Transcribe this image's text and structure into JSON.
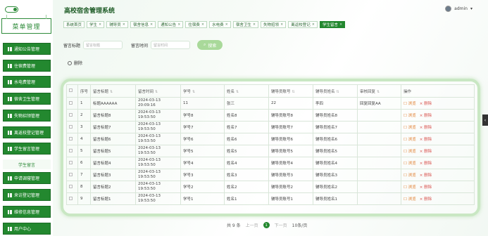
{
  "header": {
    "title": "高校宿舍管理系统",
    "user": "admin",
    "user_caret": "▾"
  },
  "sidebar": {
    "title": "菜单管理",
    "items": [
      {
        "label": "通知公告管理"
      },
      {
        "label": "住宿费管理"
      },
      {
        "label": "水电费管理"
      },
      {
        "label": "宿舍卫生管理"
      },
      {
        "label": "失物招领管理"
      },
      {
        "label": "离返校登记管理"
      },
      {
        "label": "学生留言管理"
      },
      {
        "label": "学生留言",
        "sub": true
      },
      {
        "label": "申请调寝管理"
      },
      {
        "label": "来访登记管理"
      },
      {
        "label": "维修信息管理"
      },
      {
        "label": "用户中心"
      }
    ]
  },
  "tabs": [
    {
      "label": "系统首页",
      "closable": false
    },
    {
      "label": "学生",
      "closable": true
    },
    {
      "label": "辅导员",
      "closable": true
    },
    {
      "label": "宿舍信息",
      "closable": true
    },
    {
      "label": "通知公告",
      "closable": true
    },
    {
      "label": "住宿费",
      "closable": true
    },
    {
      "label": "水电费",
      "closable": true
    },
    {
      "label": "宿舍卫生",
      "closable": true
    },
    {
      "label": "失物招领",
      "closable": true
    },
    {
      "label": "离返校登记",
      "closable": true
    },
    {
      "label": "学生留言",
      "closable": true,
      "active": true
    }
  ],
  "search": {
    "title_label": "留言标题",
    "title_placeholder": "留言标题",
    "time_label": "留言时间",
    "time_placeholder": "留言时间",
    "button": "搜索"
  },
  "delete_label": "删除",
  "table": {
    "columns": [
      "序号",
      "留言标题",
      "留言时间",
      "学号",
      "姓名",
      "辅导员账号",
      "辅导员姓名",
      "审核回复",
      "操作"
    ],
    "rows": [
      {
        "no": "1",
        "title": "标题AAAAAA",
        "time": "2024-03-13 20:09:16",
        "sid": "11",
        "name": "张三",
        "acct": "22",
        "tname": "李四",
        "reply": "回复回复AA"
      },
      {
        "no": "2",
        "title": "留言标题8",
        "time": "2024-03-13 19:53:50",
        "sid": "学号8",
        "name": "姓名8",
        "acct": "辅导员账号8",
        "tname": "辅导员姓名8",
        "reply": ""
      },
      {
        "no": "3",
        "title": "留言标题7",
        "time": "2024-03-13 19:53:50",
        "sid": "学号7",
        "name": "姓名7",
        "acct": "辅导员账号7",
        "tname": "辅导员姓名7",
        "reply": ""
      },
      {
        "no": "4",
        "title": "留言标题6",
        "time": "2024-03-13 19:53:50",
        "sid": "学号6",
        "name": "姓名6",
        "acct": "辅导员账号6",
        "tname": "辅导员姓名6",
        "reply": ""
      },
      {
        "no": "5",
        "title": "留言标题5",
        "time": "2024-03-13 19:53:50",
        "sid": "学号5",
        "name": "姓名5",
        "acct": "辅导员账号5",
        "tname": "辅导员姓名5",
        "reply": ""
      },
      {
        "no": "6",
        "title": "留言标题4",
        "time": "2024-03-13 19:53:50",
        "sid": "学号4",
        "name": "姓名4",
        "acct": "辅导员账号4",
        "tname": "辅导员姓名4",
        "reply": ""
      },
      {
        "no": "7",
        "title": "留言标题3",
        "time": "2024-03-13 19:53:50",
        "sid": "学号3",
        "name": "姓名3",
        "acct": "辅导员账号3",
        "tname": "辅导员姓名3",
        "reply": ""
      },
      {
        "no": "8",
        "title": "留言标题2",
        "time": "2024-03-13 19:53:50",
        "sid": "学号2",
        "name": "姓名2",
        "acct": "辅导员账号2",
        "tname": "辅导员姓名2",
        "reply": ""
      },
      {
        "no": "9",
        "title": "留言标题1",
        "time": "2024-03-13 19:53:50",
        "sid": "学号1",
        "name": "姓名1",
        "acct": "辅导员账号1",
        "tname": "辅导员姓名1",
        "reply": ""
      }
    ],
    "ops": {
      "view": "浏览",
      "delete": "删除"
    }
  },
  "pagination": {
    "total": "共 9 条",
    "prev": "上一页",
    "current": "1",
    "next": "下一页",
    "size": "10条/页"
  },
  "colors": {
    "primary": "#23882f",
    "accent_light": "#c9e7c3"
  }
}
